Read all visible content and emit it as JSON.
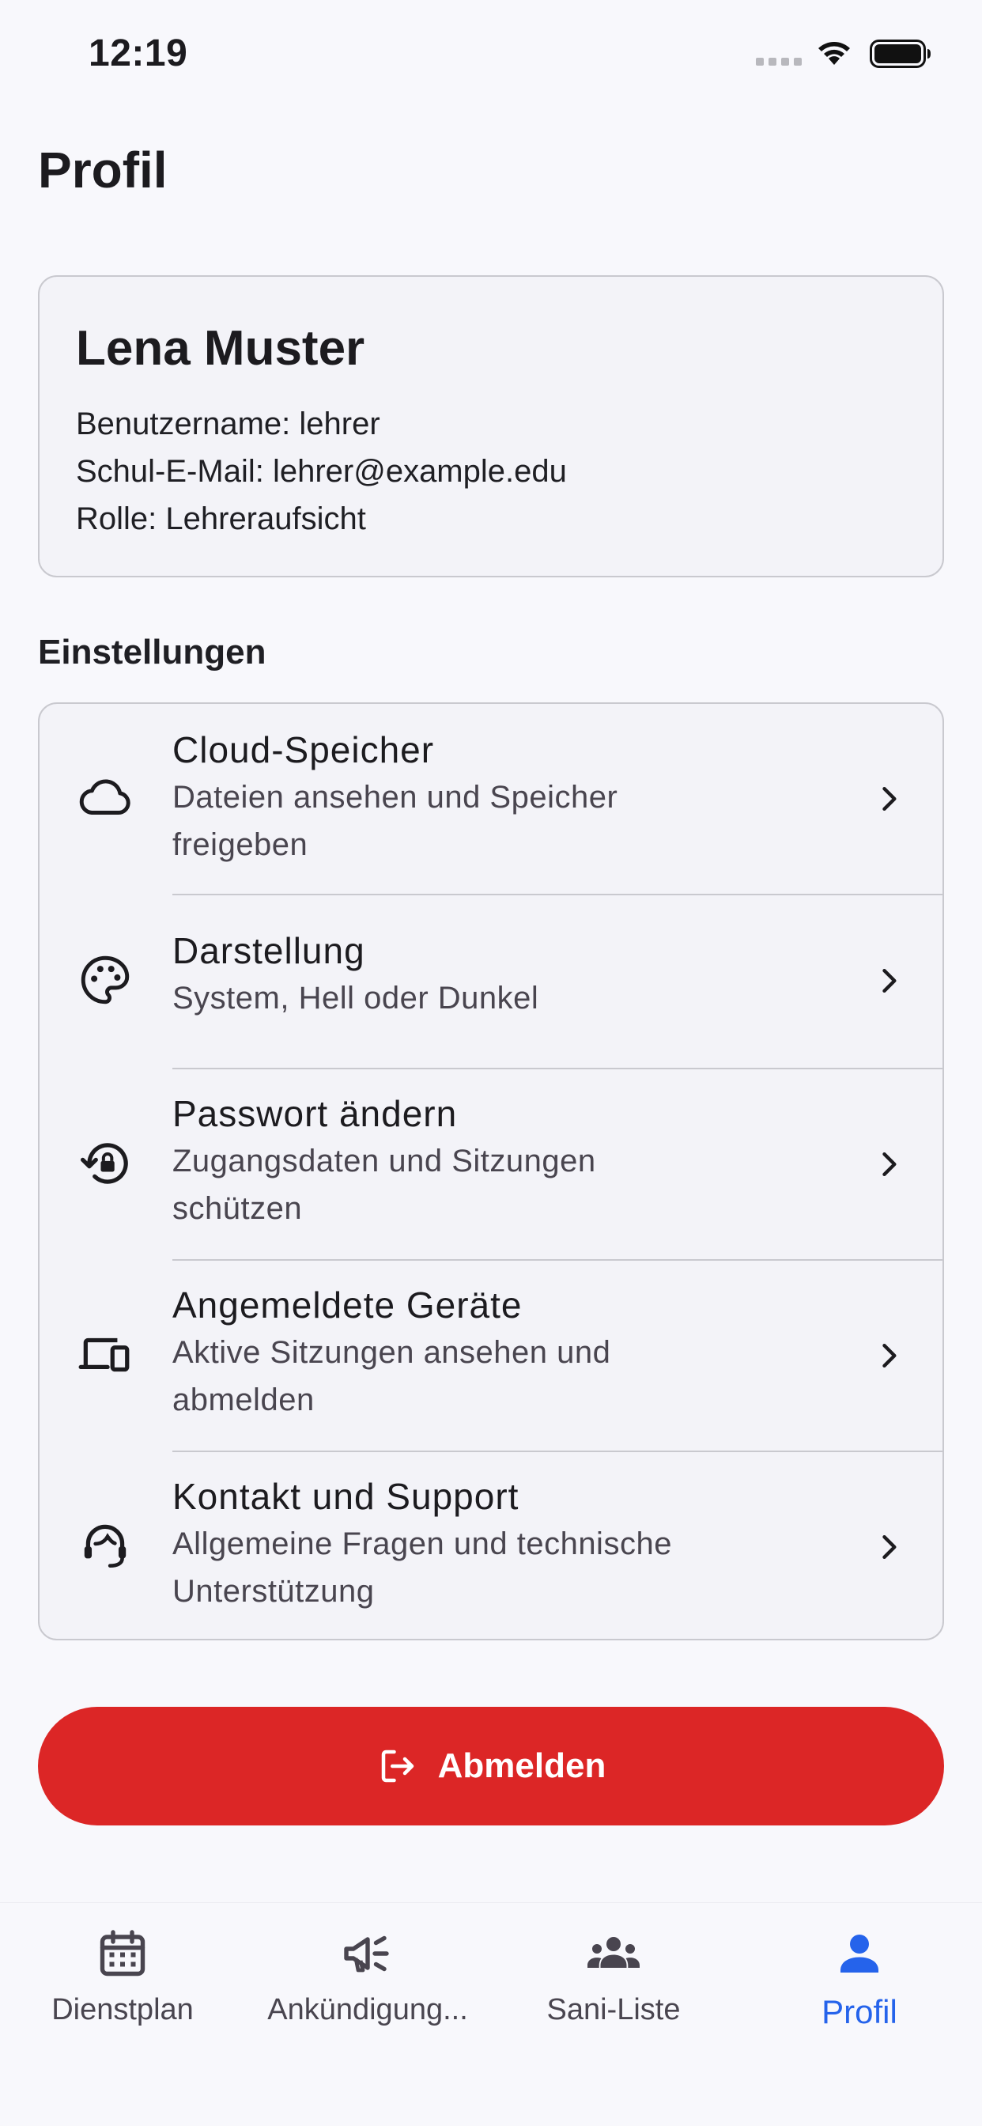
{
  "status_bar": {
    "time": "12:19"
  },
  "header": {
    "title": "Profil"
  },
  "profile": {
    "name": "Lena Muster",
    "username_line": "Benutzername: lehrer",
    "email_line": "Schul-E-Mail: lehrer@example.edu",
    "role_line": "Rolle: Lehreraufsicht"
  },
  "settings": {
    "section_title": "Einstellungen",
    "items": [
      {
        "icon": "cloud-icon",
        "title": "Cloud-Speicher",
        "subtitle_line1": "Dateien ansehen und Speicher",
        "subtitle_line2": "freigeben"
      },
      {
        "icon": "palette-icon",
        "title": "Darstellung",
        "subtitle_line1": "System, Hell oder Dunkel",
        "subtitle_line2": ""
      },
      {
        "icon": "lock-reset-icon",
        "title": "Passwort ändern",
        "subtitle_line1": "Zugangsdaten und Sitzungen",
        "subtitle_line2": "schützen"
      },
      {
        "icon": "devices-icon",
        "title": "Angemeldete Geräte",
        "subtitle_line1": "Aktive Sitzungen ansehen und",
        "subtitle_line2": "abmelden"
      },
      {
        "icon": "support-agent-icon",
        "title": "Kontakt und Support",
        "subtitle_line1": "Allgemeine Fragen und technische",
        "subtitle_line2": "Unterstützung"
      }
    ]
  },
  "logout": {
    "label": "Abmelden",
    "color": "#dc2626"
  },
  "bottom_nav": {
    "active_color": "#2563eb",
    "items": [
      {
        "icon": "calendar-icon",
        "label": "Dienstplan"
      },
      {
        "icon": "megaphone-icon",
        "label": "Ankündigung..."
      },
      {
        "icon": "group-icon",
        "label": "Sani-Liste"
      },
      {
        "icon": "person-icon",
        "label": "Profil",
        "active": true
      }
    ]
  }
}
